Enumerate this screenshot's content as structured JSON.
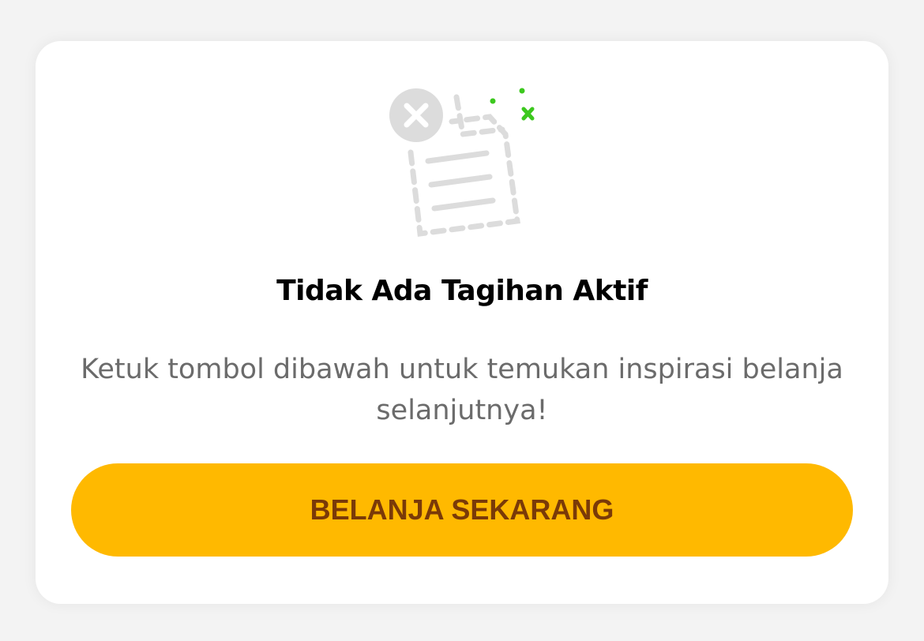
{
  "empty_state": {
    "icon": "empty-bill-icon",
    "title": "Tidak Ada Tagihan Aktif",
    "description": "Ketuk tombol dibawah untuk temukan inspirasi belanja selanjutnya!",
    "cta_label": "BELANJA SEKARANG"
  },
  "colors": {
    "background": "#f3f3f3",
    "card": "#ffffff",
    "button": "#ffb900",
    "button_text": "#7a3a08",
    "accent_green": "#3cc81e",
    "icon_gray": "#dcdcdc"
  }
}
